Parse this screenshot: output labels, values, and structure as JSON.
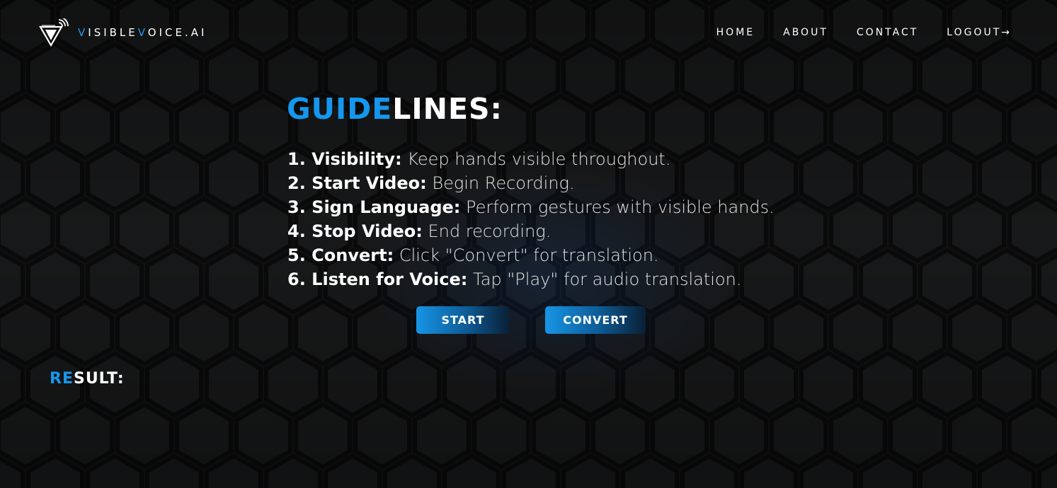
{
  "brand": {
    "part1_first": "V",
    "part1_rest": "ISIBLE",
    "part2_first": "V",
    "part2_rest": "OICE.AI",
    "logo_icon": "triangle-signal-icon"
  },
  "nav": {
    "items": [
      {
        "label": "HOME"
      },
      {
        "label": "ABOUT"
      },
      {
        "label": "CONTACT"
      },
      {
        "label": "LOGOUT→"
      }
    ]
  },
  "guidelines": {
    "title_highlight": "GUIDE",
    "title_rest": "LINES:",
    "steps": [
      {
        "label": "1. Visibility:",
        "desc": " Keep hands visible throughout."
      },
      {
        "label": "2. Start Video:",
        "desc": " Begin Recording."
      },
      {
        "label": "3. Sign Language:",
        "desc": " Perform gestures with visible hands."
      },
      {
        "label": "4. Stop Video:",
        "desc": " End recording."
      },
      {
        "label": "5. Convert:",
        "desc": " Click \"Convert\" for translation."
      },
      {
        "label": "6. Listen for Voice:",
        "desc": " Tap \"Play\" for audio translation."
      }
    ]
  },
  "buttons": {
    "start_label": "START",
    "convert_label": "CONVERT"
  },
  "result": {
    "title_highlight": "RE",
    "title_rest": "SULT:"
  },
  "colors": {
    "accent": "#1497ee",
    "background": "#131415",
    "text": "#ffffff"
  }
}
